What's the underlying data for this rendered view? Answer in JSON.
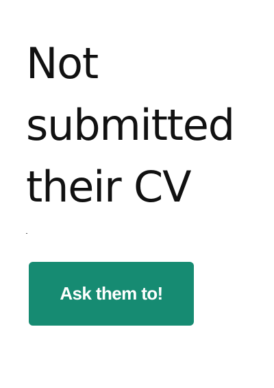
{
  "heading": {
    "lines": [
      "Not",
      "submitted",
      "their CV"
    ]
  },
  "cta": {
    "label": "Ask them to!"
  },
  "colors": {
    "button_bg": "#168b72",
    "button_text": "#ffffff",
    "heading_text": "#111111",
    "background": "#ffffff"
  }
}
